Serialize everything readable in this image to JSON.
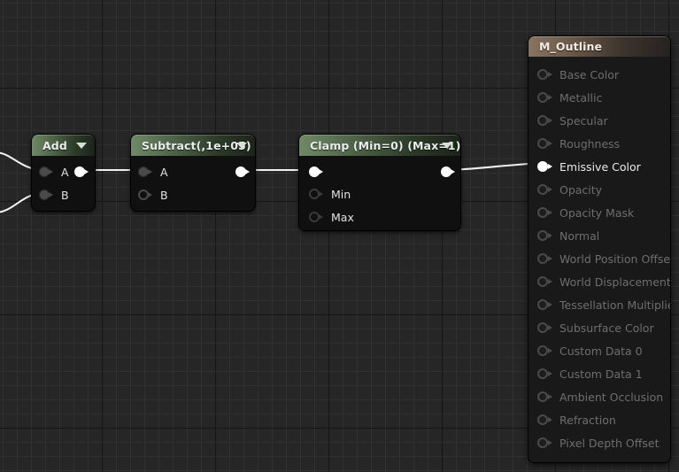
{
  "editor": {
    "name": "material-graph-editor",
    "background": "#262626",
    "grid_minor_color": "#323232",
    "grid_major_color": "#141414"
  },
  "nodes": [
    {
      "id": "add",
      "title": "Add",
      "header_color": "#4e6348",
      "inputs": [
        {
          "label": "A",
          "state": "connected"
        },
        {
          "label": "B",
          "state": "connected"
        }
      ],
      "outputs": [
        {
          "label": "",
          "state": "connected"
        }
      ]
    },
    {
      "id": "subtract",
      "title": "Subtract(,1e+05)",
      "header_color": "#4e6348",
      "inputs": [
        {
          "label": "A",
          "state": "connected"
        },
        {
          "label": "B",
          "state": "empty"
        }
      ],
      "outputs": [
        {
          "label": "",
          "state": "connected"
        }
      ]
    },
    {
      "id": "clamp",
      "title": "Clamp (Min=0) (Max=1)",
      "header_color": "#4e6348",
      "inputs": [
        {
          "label": "",
          "state": "connected"
        },
        {
          "label": "Min",
          "state": "empty"
        },
        {
          "label": "Max",
          "state": "empty"
        }
      ],
      "outputs": [
        {
          "label": "",
          "state": "connected"
        }
      ]
    }
  ],
  "material_node": {
    "title": "M_Outline",
    "header_color": "#6a5848",
    "inputs": [
      {
        "label": "Base Color",
        "connected": false
      },
      {
        "label": "Metallic",
        "connected": false
      },
      {
        "label": "Specular",
        "connected": false
      },
      {
        "label": "Roughness",
        "connected": false
      },
      {
        "label": "Emissive Color",
        "connected": true
      },
      {
        "label": "Opacity",
        "connected": false
      },
      {
        "label": "Opacity Mask",
        "connected": false
      },
      {
        "label": "Normal",
        "connected": false
      },
      {
        "label": "World Position Offset",
        "connected": false
      },
      {
        "label": "World Displacement",
        "connected": false
      },
      {
        "label": "Tessellation Multiplier",
        "connected": false
      },
      {
        "label": "Subsurface Color",
        "connected": false
      },
      {
        "label": "Custom Data 0",
        "connected": false
      },
      {
        "label": "Custom Data 1",
        "connected": false
      },
      {
        "label": "Ambient Occlusion",
        "connected": false
      },
      {
        "label": "Refraction",
        "connected": false
      },
      {
        "label": "Pixel Depth Offset",
        "connected": false
      }
    ]
  },
  "wires": {
    "color": "#f0f0f0"
  }
}
